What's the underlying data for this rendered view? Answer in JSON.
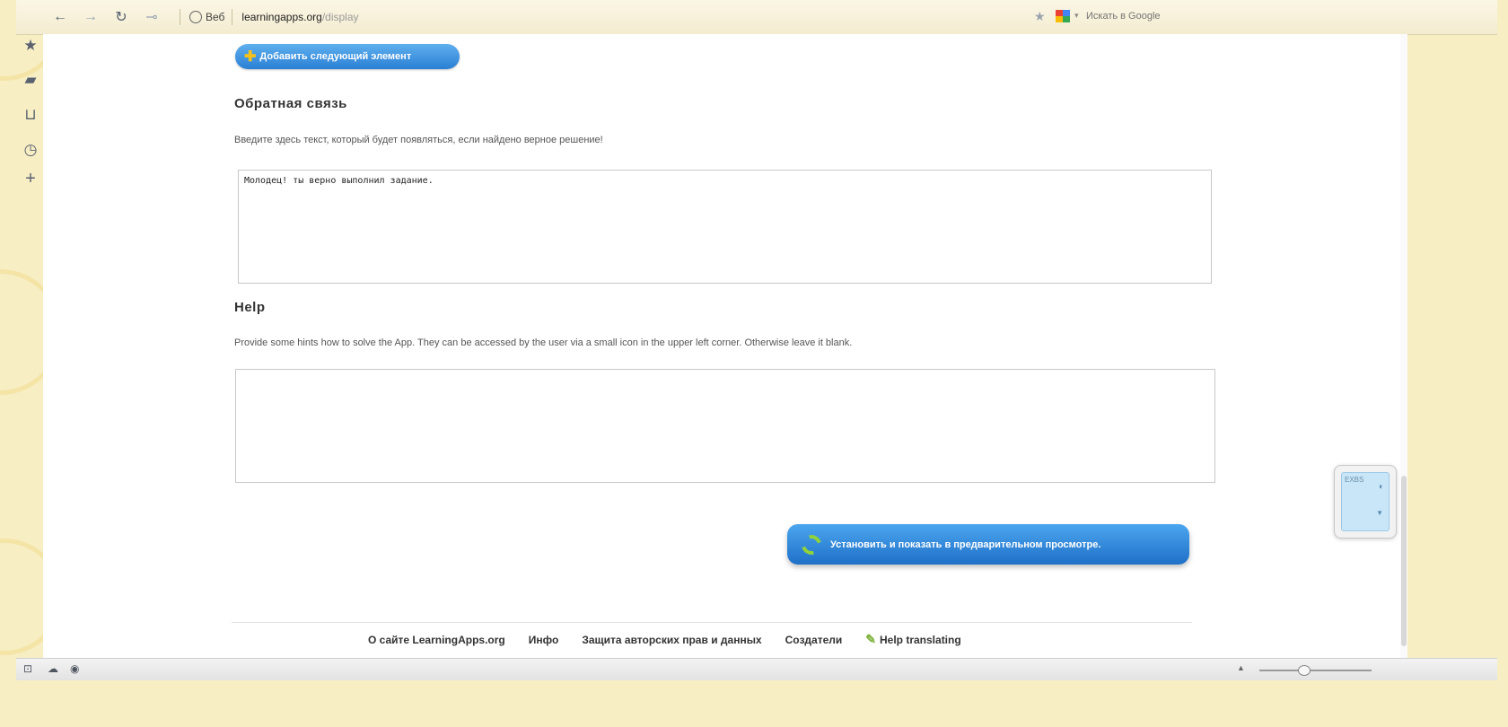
{
  "browser": {
    "tab_label": "Веб",
    "url_domain": "learningapps.org",
    "url_path": "/display",
    "search_placeholder": "Искать в Google"
  },
  "page": {
    "add_next_label": "Добавить следующий элемент",
    "feedback": {
      "title": "Обратная связь",
      "description": "Введите здесь текст, который будет появляться, если найдено верное решение!",
      "value": "Молодец! ты верно выполнил задание."
    },
    "help": {
      "title": "Help",
      "description": "Provide some hints how to solve the App. They can be accessed by the user via a small icon in the upper left corner. Otherwise leave it blank.",
      "value": ""
    },
    "preview_label": "Установить и показать в предварительном просмотре."
  },
  "footer": {
    "links": [
      "О сайте LearningApps.org",
      "Инфо",
      "Защита авторских прав и данных",
      "Создатели",
      "Help translating"
    ]
  },
  "widget": {
    "label": "EXBS"
  }
}
